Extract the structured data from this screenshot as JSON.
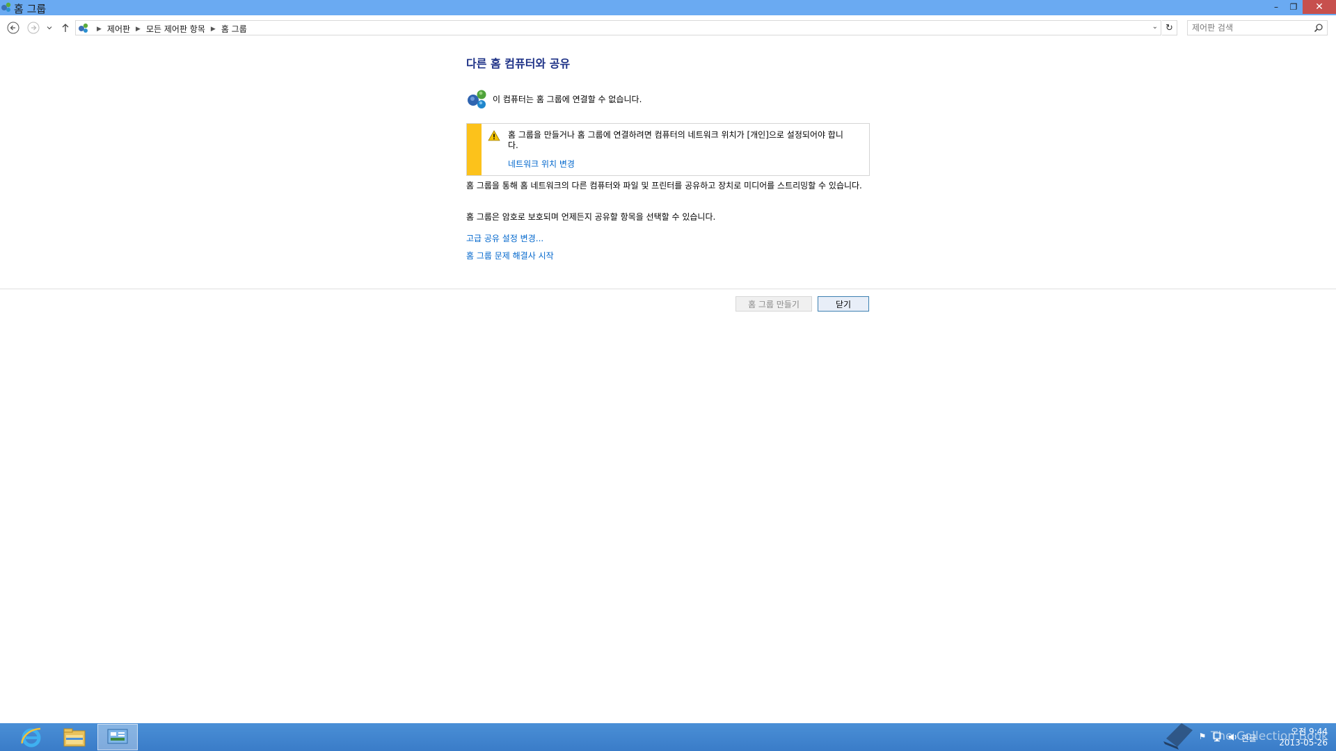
{
  "window": {
    "title": "홈 그룹",
    "minimize": "–",
    "maximize": "❐",
    "close": "✕"
  },
  "address_bar": {
    "breadcrumbs": [
      "제어판",
      "모든 제어판 항목",
      "홈 그룹"
    ]
  },
  "search": {
    "placeholder": "제어판 검색"
  },
  "main": {
    "heading": "다른 홈 컴퓨터와 공유",
    "status_text": "이 컴퓨터는 홈 그룹에 연결할 수 없습니다.",
    "warning": {
      "text": "홈 그룹을 만들거나 홈 그룹에 연결하려면 컴퓨터의 네트워크 위치가 [개인]으로 설정되어야 합니다.",
      "link": "네트워크 위치 변경"
    },
    "paragraph1": "홈 그룹을 통해 홈 네트워크의 다른 컴퓨터와 파일 및 프린터를 공유하고 장치로 미디어를 스트리밍할 수 있습니다.",
    "paragraph2": "홈 그룹은 암호로 보호되며 언제든지 공유할 항목을 선택할 수 있습니다.",
    "link_advanced": "고급 공유 설정 변경...",
    "link_troubleshoot": "홈 그룹 문제 해결사 시작"
  },
  "buttons": {
    "create": "홈 그룹 만들기",
    "close": "닫기"
  },
  "taskbar": {
    "ime": "한글",
    "time": "오전 9:44",
    "date": "2013-05-26",
    "watermark": "The Collection Book"
  },
  "colors": {
    "titlebar": "#6aaaf2",
    "heading": "#1e3287",
    "link": "#0066cc",
    "warning_bar": "#fcc21b",
    "taskbar": "#3a7cc8"
  }
}
